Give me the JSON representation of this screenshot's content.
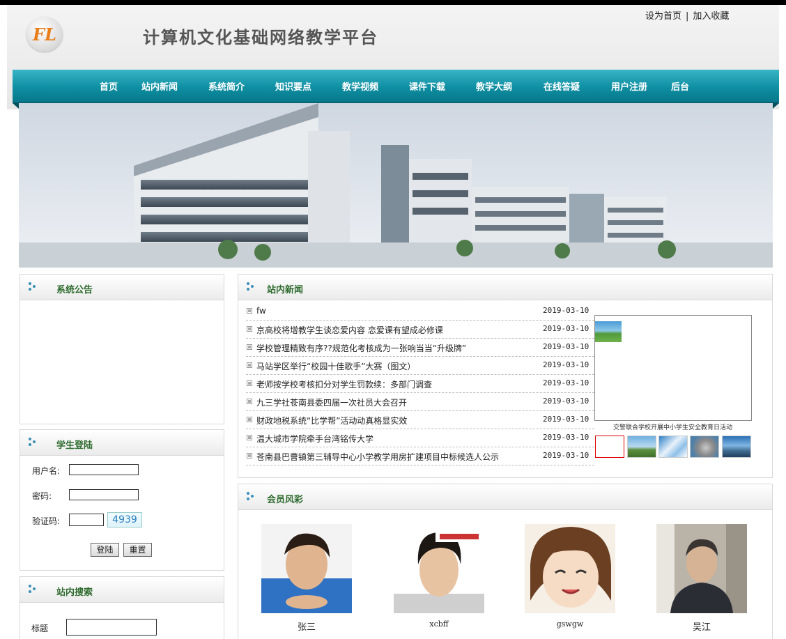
{
  "header": {
    "logo_text": "FL",
    "site_title": "计算机文化基础网络教学平台",
    "top_links": [
      "设为首页",
      "加入收藏"
    ],
    "top_link_separator": "|"
  },
  "nav": {
    "items": [
      "首页",
      "站内新闻",
      "系统简介",
      "知识要点",
      "教学视频",
      "课件下载",
      "教学大纲",
      "在线答疑",
      "用户注册",
      "后台"
    ]
  },
  "sidebar": {
    "announcement_title": "系统公告",
    "login": {
      "title": "学生登陆",
      "username_label": "用户名:",
      "password_label": "密码:",
      "captcha_label": "验证码:",
      "captcha_value": "4939",
      "login_button": "登陆",
      "reset_button": "重置"
    },
    "search": {
      "title": "站内搜索",
      "title_label": "标题"
    }
  },
  "news": {
    "title": "站内新闻",
    "items": [
      {
        "title": "fw",
        "date": "2019-03-10"
      },
      {
        "title": "京高校将增教学生谈恋爱内容 恋爱课有望成必修课",
        "date": "2019-03-10"
      },
      {
        "title": "学校管理精致有序??规范化考核成为一张响当当“升级牌”",
        "date": "2019-03-10"
      },
      {
        "title": "马站学区举行“校园十佳歌手”大赛（图文）",
        "date": "2019-03-10"
      },
      {
        "title": "老师按学校考核扣分对学生罚款续：多部门调查",
        "date": "2019-03-10"
      },
      {
        "title": "九三学社苍南县委四届一次社员大会召开",
        "date": "2019-03-10"
      },
      {
        "title": "财政地税系统“比学帮”活动动真格显实效",
        "date": "2019-03-10"
      },
      {
        "title": "温大城市学院牵手台湾铭传大学",
        "date": "2019-03-10"
      },
      {
        "title": "苍南县巴曹镇第三辅导中心小学教学用房扩建项目中标候选人公示",
        "date": "2019-03-10"
      }
    ],
    "slideshow_caption": "交警联合学校开展中小学生安全教育日活动"
  },
  "members": {
    "title": "会员风彩",
    "items": [
      {
        "name": "张三"
      },
      {
        "name": "xcbff"
      },
      {
        "name": "gswgw"
      },
      {
        "name": "吴江"
      }
    ]
  },
  "colors": {
    "nav_gradient_top": "#38b6c6",
    "nav_gradient_bottom": "#07788a",
    "panel_title": "#2e6b2e",
    "logo_orange": "#e87d1a"
  }
}
